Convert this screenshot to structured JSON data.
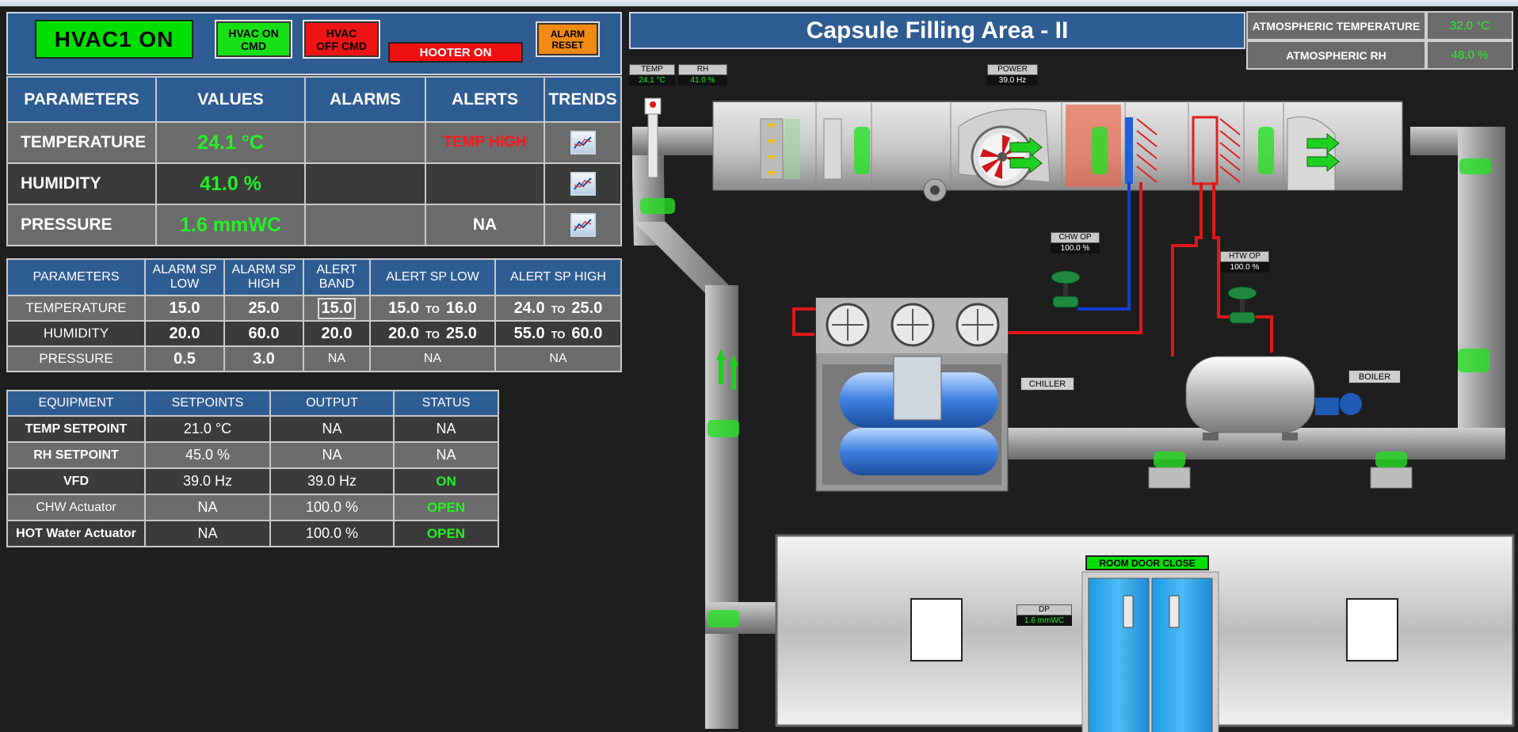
{
  "header": {
    "hvac_state": "HVAC1  ON",
    "btn_on": "HVAC ON CMD",
    "btn_off": "HVAC OFF CMD",
    "hooter": "HOOTER ON",
    "btn_reset": "ALARM RESET"
  },
  "params_table": {
    "headers": [
      "PARAMETERS",
      "VALUES",
      "ALARMS",
      "ALERTS",
      "TRENDS"
    ],
    "rows": [
      {
        "name": "TEMPERATURE",
        "value": "24.1 °C",
        "alarm": "",
        "alert": "TEMP HIGH"
      },
      {
        "name": "HUMIDITY",
        "value": "41.0 %",
        "alarm": "",
        "alert": ""
      },
      {
        "name": "PRESSURE",
        "value": "1.6 mmWC",
        "alarm": "",
        "alert": "NA"
      }
    ]
  },
  "sp_table": {
    "headers": [
      "PARAMETERS",
      "ALARM SP LOW",
      "ALARM SP HIGH",
      "ALERT BAND",
      "ALERT SP LOW",
      "ALERT SP HIGH"
    ],
    "to": "TO",
    "rows": [
      {
        "name": "TEMPERATURE",
        "low": "15.0",
        "high": "25.0",
        "band": "15.0",
        "alow_a": "15.0",
        "alow_b": "16.0",
        "ahigh_a": "24.0",
        "ahigh_b": "25.0"
      },
      {
        "name": "HUMIDITY",
        "low": "20.0",
        "high": "60.0",
        "band": "20.0",
        "alow_a": "20.0",
        "alow_b": "25.0",
        "ahigh_a": "55.0",
        "ahigh_b": "60.0"
      },
      {
        "name": "PRESSURE",
        "low": "0.5",
        "high": "3.0",
        "band": "NA",
        "alow": "NA",
        "ahigh": "NA"
      }
    ]
  },
  "equip_table": {
    "headers": [
      "EQUIPMENT",
      "SETPOINTS",
      "OUTPUT",
      "STATUS"
    ],
    "rows": [
      {
        "name": "TEMP SETPOINT",
        "sp": "21.0 °C",
        "out": "NA",
        "status": "NA"
      },
      {
        "name": "RH SETPOINT",
        "sp": "45.0 %",
        "out": "NA",
        "status": "NA"
      },
      {
        "name": "VFD",
        "sp": "39.0 Hz",
        "out": "39.0 Hz",
        "status": "ON"
      },
      {
        "name": "CHW Actuator",
        "sp": "NA",
        "out": "100.0 %",
        "status": "OPEN"
      },
      {
        "name": "HOT Water Actuator",
        "sp": "NA",
        "out": "100.0 %",
        "status": "OPEN"
      }
    ]
  },
  "area": {
    "title": "Capsule Filling Area - II",
    "atm_temp_label": "ATMOSPHERIC TEMPERATURE",
    "atm_temp_value": "32.0 °C",
    "atm_rh_label": "ATMOSPHERIC RH",
    "atm_rh_value": "48.0 %"
  },
  "tags": {
    "temp_label": "TEMP",
    "temp_value": "24.1 °C",
    "rh_label": "RH",
    "rh_value": "41.0 %",
    "power_label": "POWER",
    "power_value": "39.0 Hz",
    "chw_label": "CHW OP",
    "chw_value": "100.0 %",
    "htw_label": "HTW OP",
    "htw_value": "100.0 %",
    "chiller": "CHILLER",
    "boiler": "BOILER",
    "door": "ROOM DOOR CLOSE",
    "dp_label": "DP",
    "dp_value": "1.6 mmWC"
  },
  "colors": {
    "header_blue": "#2e5d93",
    "ok_green": "#25f025",
    "alarm_red": "#ee1414",
    "reset_orange": "#f08a10"
  }
}
